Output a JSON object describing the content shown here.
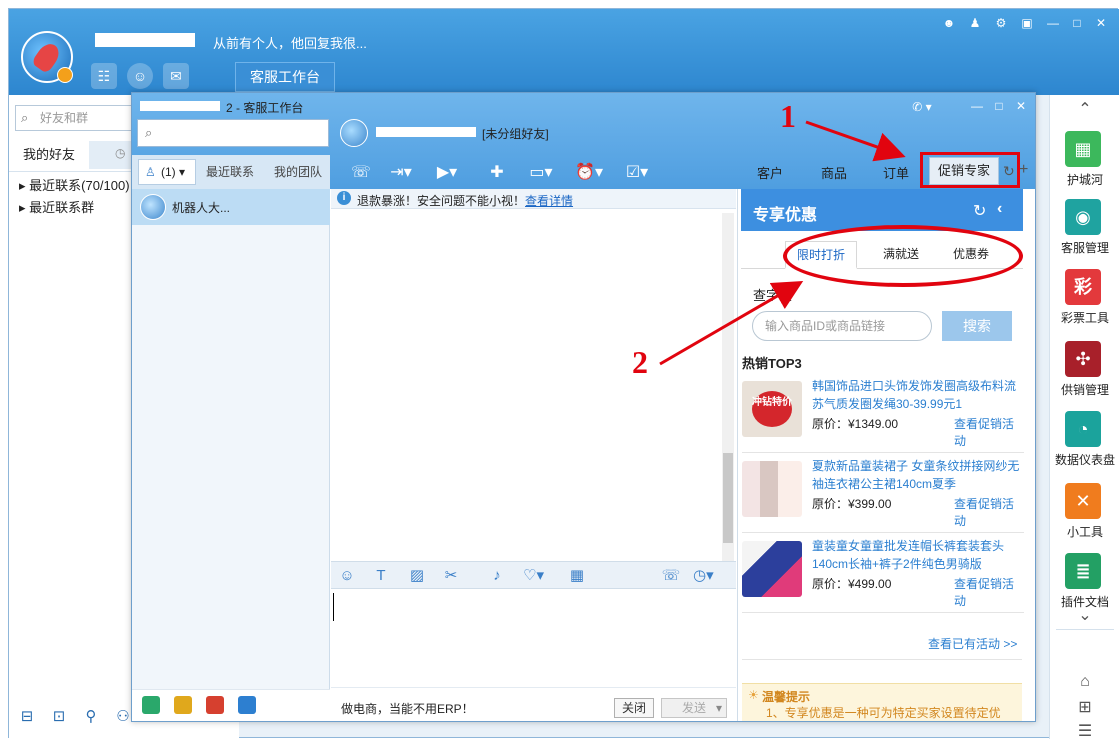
{
  "main": {
    "status_text": "从前有个人，他回复我很...",
    "workbench_tab": "客服工作台",
    "search_placeholder": "好友和群",
    "friends_tab": "我的好友",
    "contacts": [
      "最近联系(70/100)",
      "最近联系群"
    ]
  },
  "rail": {
    "items": [
      "护城河",
      "客服管理",
      "彩票工具",
      "供销管理",
      "数据仪表盘",
      "小工具",
      "插件文档"
    ],
    "tile_glyphs": [
      "▦",
      "◉",
      "彩",
      "✣",
      "◔",
      "✕",
      "≣"
    ],
    "tile_colors": [
      "#3cb85c",
      "#1fa3a0",
      "#e3393c",
      "#a8202a",
      "#1ba39c",
      "#f07c1e",
      "#23a064"
    ]
  },
  "chat": {
    "title": "2 - 客服工作台",
    "search_placeholder": "",
    "peer_group": "[未分组好友]",
    "left_tabs": {
      "people": "(1)",
      "recent": "最近联系",
      "team": "我的团队"
    },
    "conv_name": "机器人大...",
    "notice_text": "退款暴涨！安全问题不能小视！",
    "notice_link": "查看详情",
    "slogan": "做电商，当能不用ERP！",
    "close_label": "关闭",
    "send_label": "发送",
    "right_tabs": [
      "客户",
      "商品",
      "订单",
      "促销专家"
    ]
  },
  "promo": {
    "title": "专享优惠",
    "tabs": [
      "限时打折",
      "满就送",
      "优惠券"
    ],
    "check_label": "查字段",
    "input_placeholder": "输入商品ID或商品链接",
    "search_label": "搜索",
    "top3_label": "热销TOP3",
    "products": [
      {
        "title": "韩国饰品进口头饰发饰发圈高级布料流苏气质发圈发绳30-39.99元1",
        "price": "原价：¥1349.00",
        "link": "查看促销活动",
        "img_text": "冲钻特价"
      },
      {
        "title": "夏款新品童装裙子 女童条纹拼接网纱无袖连衣裙公主裙140cm夏季",
        "price": "原价：¥399.00",
        "link": "查看促销活动",
        "img_text": ""
      },
      {
        "title": "童装童女童童批发连帽长裤套装套头140cm长袖+裤子2件纯色男骑版",
        "price": "原价：¥499.00",
        "link": "查看促销活动",
        "img_text": ""
      }
    ],
    "view_all": "查看已有活动 >>",
    "tips_title": "温馨提示",
    "tips_text": "1、专享优惠是一种可为特定买家设置待定优"
  },
  "annotations": {
    "one": "1",
    "two": "2"
  },
  "colors": {
    "accent": "#3d8fe0",
    "annotation_red": "#e1040f"
  }
}
